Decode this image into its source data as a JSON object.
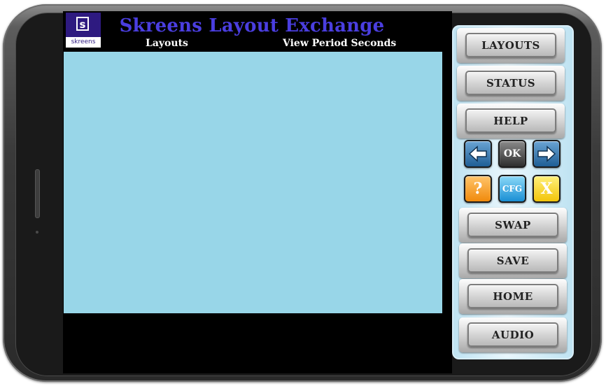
{
  "app": {
    "title": "Skreens Layout Exchange",
    "logo_mark": "s",
    "logo_word": "skreens"
  },
  "columns": {
    "layouts": "Layouts",
    "view_period": "View Period Seconds"
  },
  "panel": {
    "menu": [
      "LAYOUTS",
      "STATUS",
      "HELP"
    ],
    "nav": {
      "left_icon": "arrow-left-icon",
      "ok": "OK",
      "right_icon": "arrow-right-icon"
    },
    "tools": {
      "help": "?",
      "cfg": "CFG",
      "close": "X"
    },
    "actions": [
      "SWAP",
      "SAVE",
      "HOME",
      "AUDIO"
    ]
  },
  "colors": {
    "title": "#4a3ee0",
    "content_background": "#98d6e8",
    "logo_background": "#2e1a80",
    "panel_background": "#bfe3f2"
  }
}
